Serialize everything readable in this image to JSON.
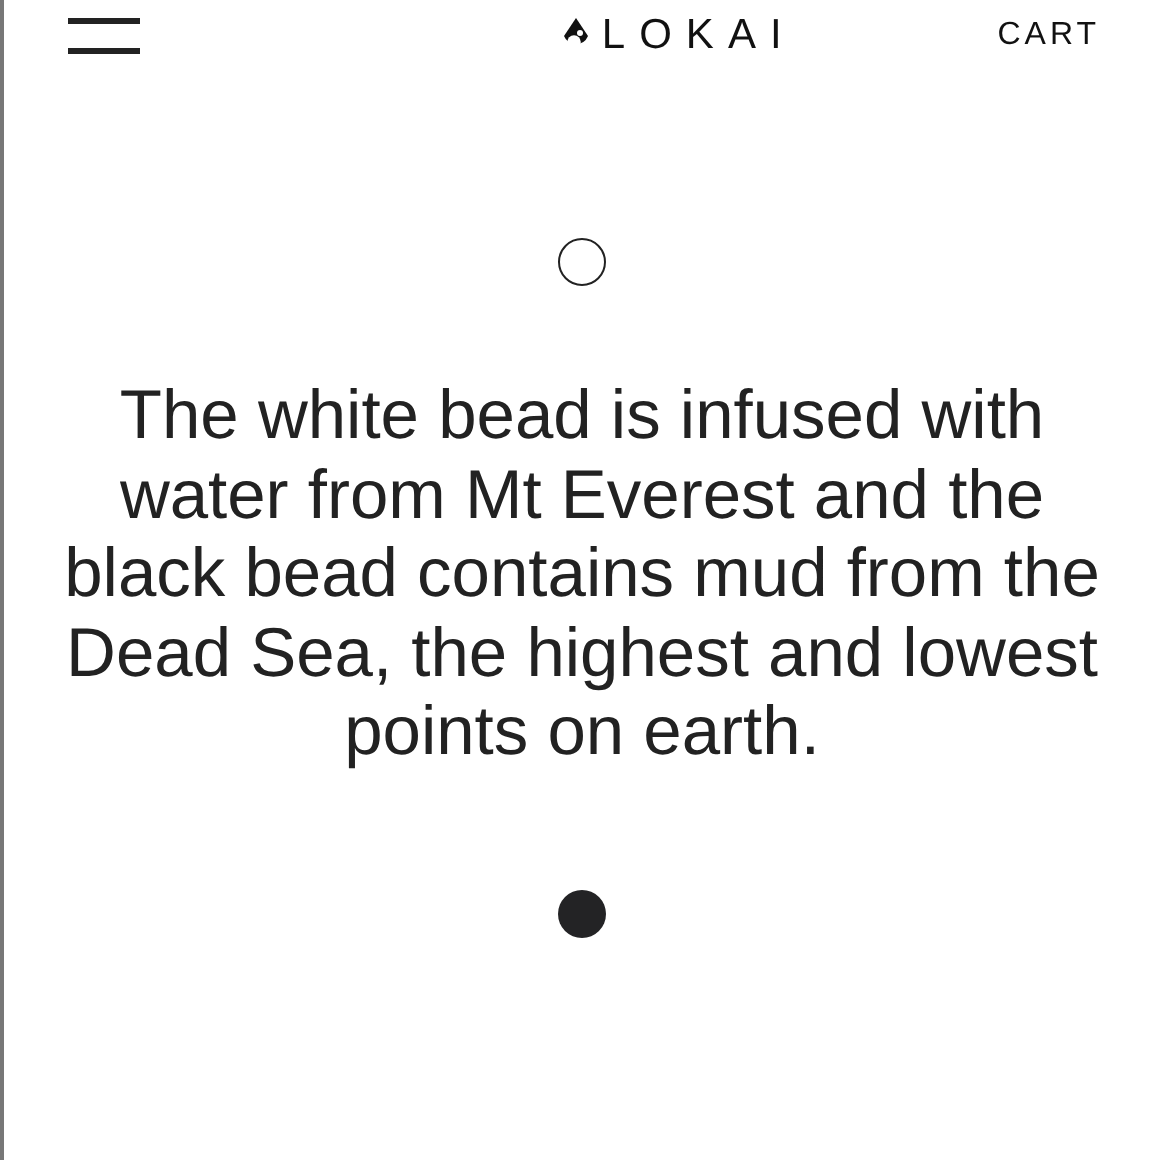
{
  "header": {
    "brand": "LOKAI",
    "cart": "CART"
  },
  "beads": [
    {
      "kind": "outline"
    },
    {
      "kind": "filled"
    }
  ],
  "description": "The white bead is infused with water from Mt Everest and the black bead contains mud from the Dead Sea, the highest and lowest points on earth."
}
